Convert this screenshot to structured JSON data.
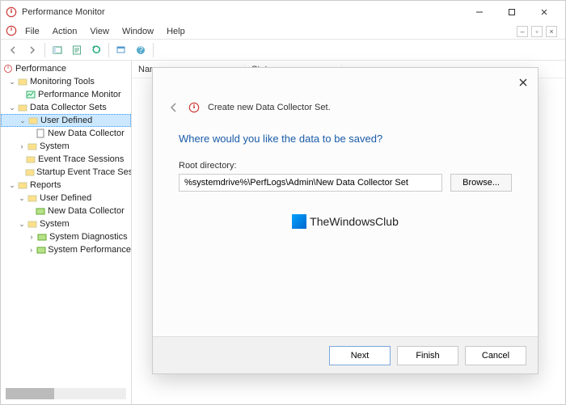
{
  "window": {
    "title": "Performance Monitor"
  },
  "menus": {
    "file": "File",
    "action": "Action",
    "view": "View",
    "window": "Window",
    "help": "Help"
  },
  "columns": {
    "name": "Name",
    "status": "Status"
  },
  "tree": {
    "root": "Performance",
    "monitoring_tools": "Monitoring Tools",
    "performance_monitor": "Performance Monitor",
    "data_collector_sets": "Data Collector Sets",
    "user_defined": "User Defined",
    "new_data_collector": "New Data Collector",
    "system": "System",
    "event_trace_sessions": "Event Trace Sessions",
    "startup_event_trace": "Startup Event Trace Sess",
    "reports": "Reports",
    "reports_user_defined": "User Defined",
    "reports_new_data_collector": "New Data Collector",
    "reports_system": "System",
    "system_diagnostics": "System Diagnostics",
    "system_performance": "System Performance"
  },
  "dialog": {
    "title": "Create new Data Collector Set.",
    "heading": "Where would you like the data to be saved?",
    "root_dir_label": "Root directory:",
    "root_dir_value": "%systemdrive%\\PerfLogs\\Admin\\New Data Collector Set",
    "browse": "Browse...",
    "next": "Next",
    "finish": "Finish",
    "cancel": "Cancel"
  },
  "watermark": {
    "text": "TheWindowsClub"
  }
}
